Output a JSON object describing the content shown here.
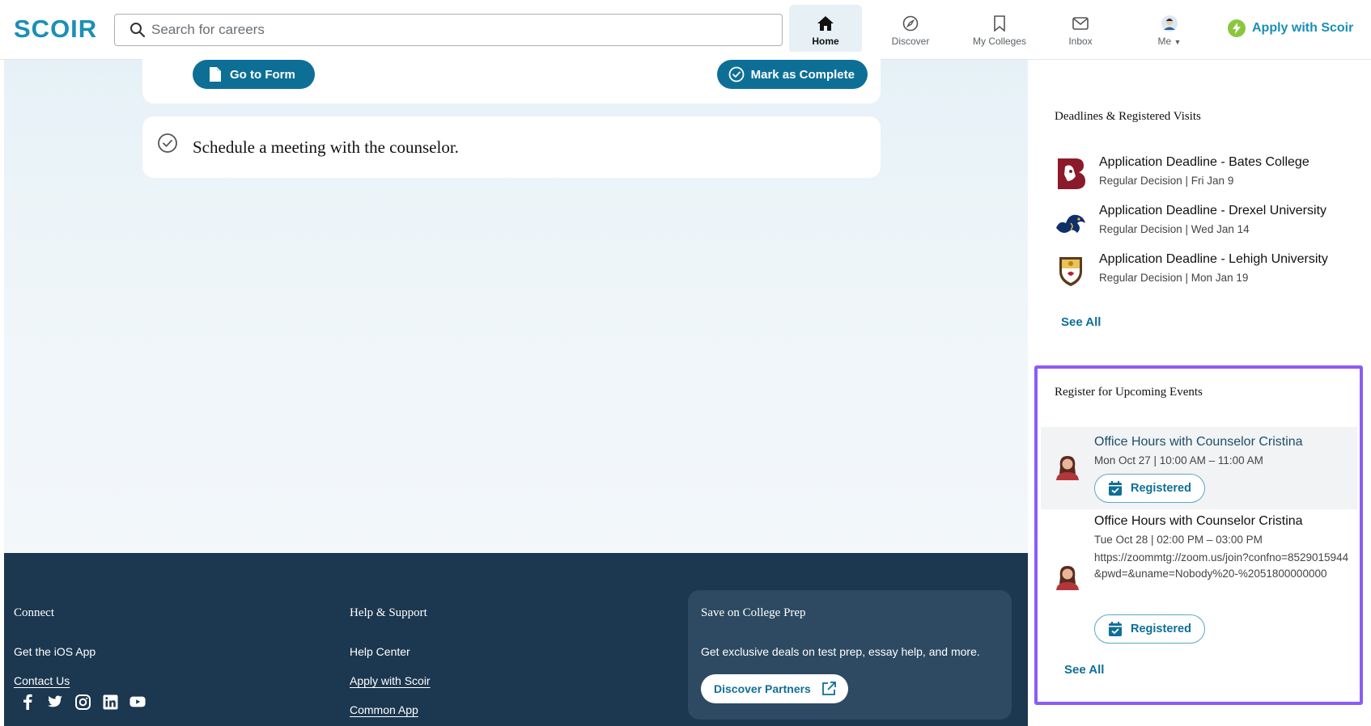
{
  "app": {
    "logo_text": "SCOIR",
    "accent": "#1a8fb7",
    "primary": "#0e6f96",
    "highlight": "#8b5cf6"
  },
  "search": {
    "placeholder": "Search for careers"
  },
  "nav": {
    "home": {
      "label": "Home",
      "icon": "home-icon"
    },
    "discover": {
      "label": "Discover",
      "icon": "compass-icon"
    },
    "colleges": {
      "label": "My Colleges",
      "icon": "bookmark-icon"
    },
    "inbox": {
      "label": "Inbox",
      "icon": "mail-icon"
    },
    "me": {
      "label": "Me",
      "icon": "avatar-icon"
    },
    "apply": {
      "label": "Apply with Scoir",
      "icon": "bolt-icon"
    }
  },
  "main": {
    "go_to_form": "Go to Form",
    "mark_complete": "Mark as Complete",
    "task": "Schedule a meeting with the counselor."
  },
  "deadlines": {
    "title": "Deadlines & Registered Visits",
    "items": [
      {
        "title": "Application Deadline - Bates College",
        "sub": "Regular Decision | Fri Jan 9",
        "icon": "bates-logo"
      },
      {
        "title": "Application Deadline - Drexel University",
        "sub": "Regular Decision | Wed Jan 14",
        "icon": "drexel-logo"
      },
      {
        "title": "Application Deadline - Lehigh University",
        "sub": "Regular Decision | Mon Jan 19",
        "icon": "lehigh-logo"
      }
    ],
    "see_all": "See All"
  },
  "events": {
    "title": "Register for Upcoming Events",
    "items": [
      {
        "title": "Office Hours with Counselor Cristina",
        "time": "Mon Oct 27 | 10:00 AM – 11:00 AM",
        "link": "",
        "status": "Registered"
      },
      {
        "title": "Office Hours with Counselor Cristina",
        "time": "Tue Oct 28 | 02:00 PM – 03:00 PM",
        "link": "https://zoommtg://zoom.us/join?confno=8529015944&pwd=&uname=Nobody%20-%2051800000000",
        "status": "Registered"
      }
    ],
    "see_all": "See All"
  },
  "footer": {
    "connect": {
      "title": "Connect",
      "links": [
        "Get the iOS App",
        "Contact Us"
      ]
    },
    "help": {
      "title": "Help & Support",
      "links": [
        "Help Center",
        "Apply with Scoir",
        "Common App"
      ]
    },
    "promo": {
      "title": "Save on College Prep",
      "text": "Get exclusive deals on test prep, essay help, and more.",
      "button": "Discover Partners"
    },
    "social": [
      "facebook-icon",
      "twitter-icon",
      "instagram-icon",
      "linkedin-icon",
      "youtube-icon"
    ]
  }
}
